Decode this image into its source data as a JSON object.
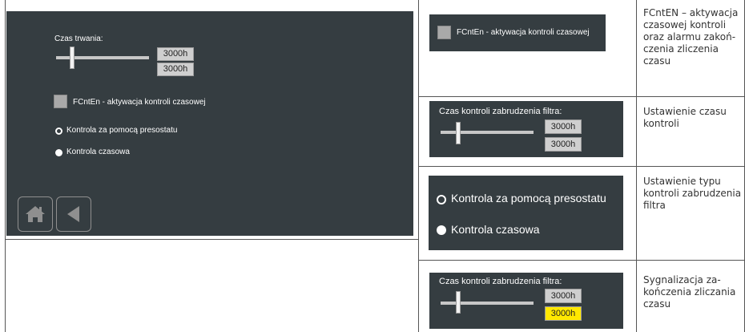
{
  "main_screen": {
    "duration_label": "Czas trwania:",
    "value_set": "3000h",
    "value_current": "3000h",
    "checkbox_label": "FCntEn - aktywacja kontroli czasowej",
    "radio_pressostat_label": "Kontrola za pomocą presostatu",
    "radio_time_label": "Kontrola czasowa",
    "nav": {
      "home_icon": "home-icon",
      "back_icon": "back-arrow-icon"
    }
  },
  "rows": [
    {
      "snippet": {
        "checkbox_label": "FCntEn - aktywacja kontroli czasowej"
      },
      "description": [
        "FCntEN – aktywacja",
        "czasowej kontroli",
        "oraz alarmu zakoń-",
        "czenia zliczenia",
        "czasu"
      ]
    },
    {
      "snippet": {
        "slider_label": "Czas kontroli zabrudzenia filtra:",
        "value_set": "3000h",
        "value_current": "3000h"
      },
      "description": [
        "Ustawienie czasu",
        "kontroli"
      ]
    },
    {
      "snippet": {
        "radio_pressostat_label": "Kontrola za pomocą presostatu",
        "radio_time_label": "Kontrola czasowa"
      },
      "description": [
        "Ustawienie typu",
        "kontroli zabrudzenia",
        "filtra"
      ]
    },
    {
      "snippet": {
        "slider_label": "Czas kontroli zabrudzenia filtra:",
        "value_set": "3000h",
        "value_current": "3000h"
      },
      "description": [
        "Sygnalizacja za-",
        "kończenia zliczania",
        "czasu"
      ]
    }
  ],
  "colors": {
    "panel_bg": "#353d41",
    "alarm_highlight": "#ffe800",
    "grid_line": "#555555"
  }
}
